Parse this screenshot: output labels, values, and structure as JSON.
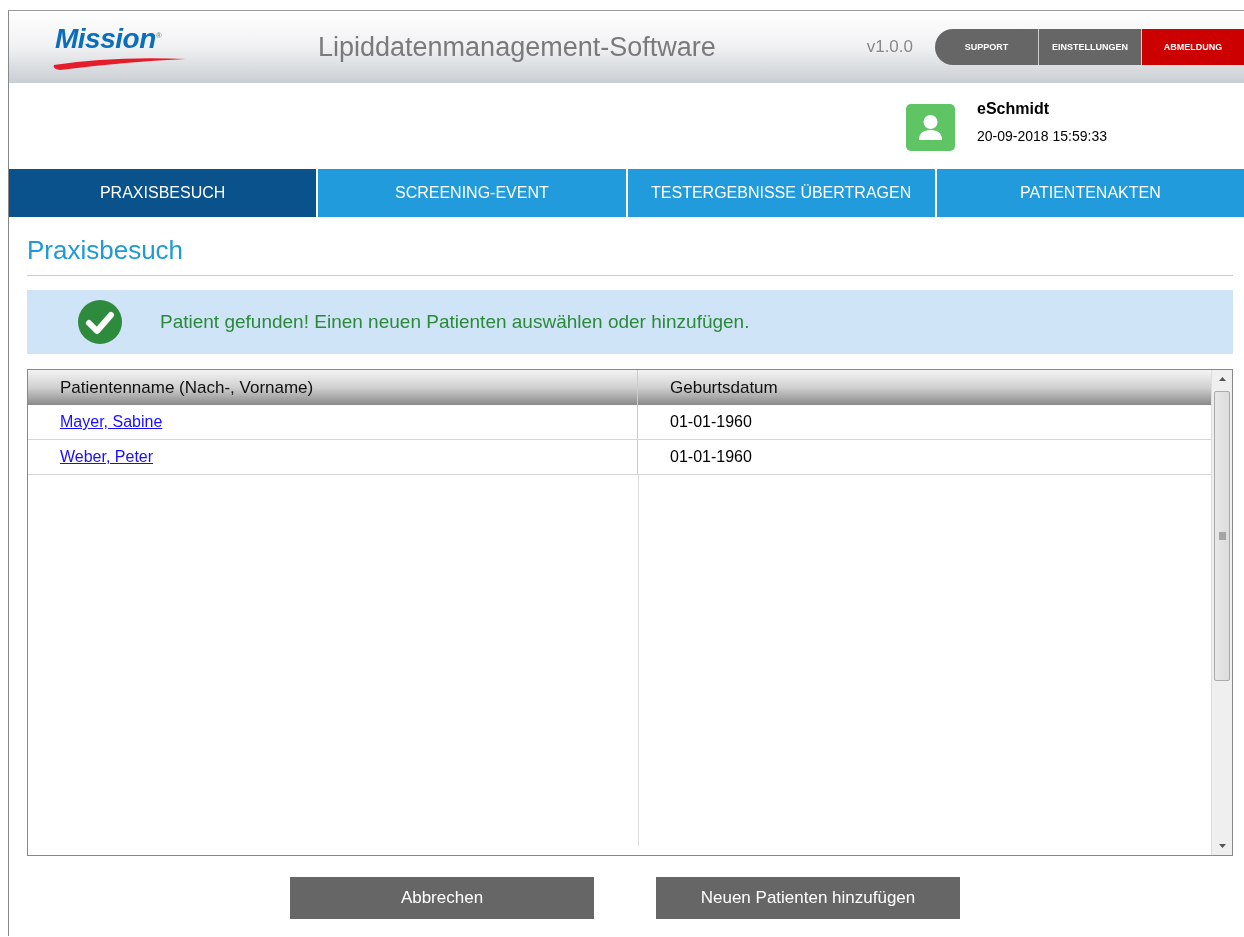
{
  "header": {
    "logo": "Mission$^{®}$",
    "title": "Lipiddatenmanagement-Software",
    "version": "v1.0.0",
    "buttons": [
      {
        "label": "SUPPORT",
        "kind": "normal"
      },
      {
        "label": "EINSTELLUNGEN",
        "kind": "normal"
      },
      {
        "label": "ABMELDUNG",
        "kind": "danger"
      }
    ]
  },
  "user": {
    "name": "eSchmidt",
    "datetime": "20-09-2018 15:59:33"
  },
  "tabs": [
    {
      "label": "PRAXISBESUCH",
      "selected": true
    },
    {
      "label": "SCREENING-EVENT",
      "selected": false
    },
    {
      "label": "TESTERGEBNISSE ÜBERTRAGEN",
      "selected": false
    },
    {
      "label": "PATIENTENAKTEN",
      "selected": false
    }
  ],
  "page_title": "Praxisbesuch",
  "alert": {
    "kind": "success",
    "message": "Patient gefunden! Einen neuen Patienten auswählen oder hinzufügen."
  },
  "table": {
    "columns": [
      "Patientenname (Nach-, Vorname)",
      "Geburtsdatum"
    ],
    "rows": [
      {
        "name": "Mayer, Sabine",
        "birthdate": "01-01-1960"
      },
      {
        "name": "Weber, Peter",
        "birthdate": "01-01-1960"
      }
    ]
  },
  "actions": [
    "Abbrechen",
    "Neuen Patienten hinzufügen"
  ]
}
